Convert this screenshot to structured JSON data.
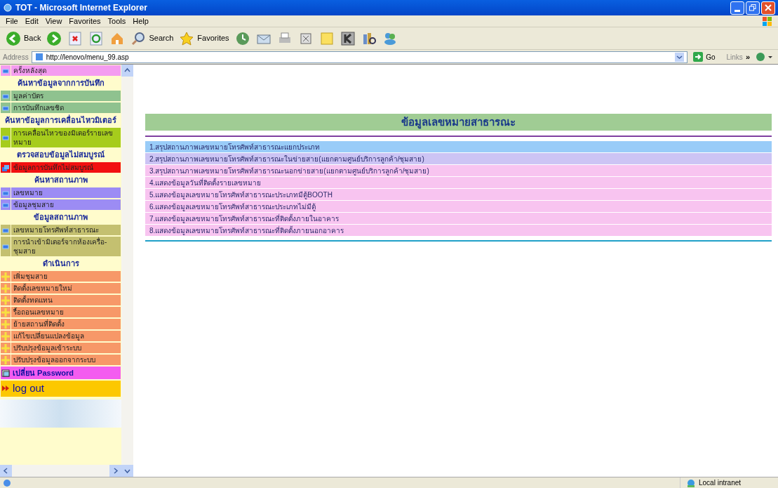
{
  "window": {
    "title": "TOT - Microsoft Internet Explorer"
  },
  "menu": [
    "File",
    "Edit",
    "View",
    "Favorites",
    "Tools",
    "Help"
  ],
  "toolbar": [
    {
      "kind": "back",
      "label": "Back"
    },
    {
      "kind": "forward"
    },
    {
      "kind": "stop"
    },
    {
      "kind": "refresh"
    },
    {
      "kind": "home"
    },
    {
      "kind": "search",
      "label": "Search"
    },
    {
      "kind": "favorites",
      "label": "Favorites"
    },
    {
      "kind": "history"
    },
    {
      "kind": "mail"
    },
    {
      "kind": "print"
    },
    {
      "kind": "edit"
    },
    {
      "kind": "note"
    },
    {
      "kind": "k"
    },
    {
      "kind": "research"
    },
    {
      "kind": "messenger"
    }
  ],
  "address": {
    "label": "Address",
    "value": "http://lenovo/menu_99.asp",
    "go": "Go",
    "links": "Links",
    "chevron": "»"
  },
  "sidebar": [
    {
      "kind": "bullet",
      "label": "ครั้งหลังสุด",
      "color": "#f49cf0"
    },
    {
      "kind": "header",
      "label": "ค้นหาข้อมูลจากการบันทึก"
    },
    {
      "kind": "bullet",
      "label": "มูลค่าบัตร",
      "color": "#8fc28f"
    },
    {
      "kind": "bullet",
      "label": "การบันทึกเลขชิด",
      "color": "#8fc28f"
    },
    {
      "kind": "header",
      "label": "ค้นหาข้อมูลการเคลื่อนไหวมิเตอร์"
    },
    {
      "kind": "bullet",
      "label": "การเคลื่อนไหวของมิเตอร์รายเลขหมาย",
      "color": "#a6cc1c"
    },
    {
      "kind": "header",
      "label": "ตรวจสอบข้อมูลไม่สมบูรณ์"
    },
    {
      "kind": "window",
      "label": "ข้อมูลการบันทึกไม่สมบูรณ์",
      "color": "#f21010"
    },
    {
      "kind": "header",
      "label": "ค้นหาสถานภาพ"
    },
    {
      "kind": "bullet",
      "label": "เลขหมาย",
      "color": "#9c8cf4"
    },
    {
      "kind": "bullet",
      "label": "ข้อมูลชุมสาย",
      "color": "#9c8cf4"
    },
    {
      "kind": "header",
      "label": "ข้อมูลสถานภาพ"
    },
    {
      "kind": "bullet",
      "label": "เลขหมายโทรศัพท์สาธารณะ",
      "color": "#c4c070"
    },
    {
      "kind": "bullet",
      "label": "การนำเข้ามิเตอร์จากห้องเครื่อ-ชุมสาย",
      "color": "#c4c070"
    },
    {
      "kind": "header",
      "label": "ดำเนินการ"
    },
    {
      "kind": "plus",
      "label": "เพิ่มชุมสาย",
      "color": "#f79868"
    },
    {
      "kind": "plus",
      "label": "ติดตั้งเลขหมายใหม่",
      "color": "#f79868"
    },
    {
      "kind": "plus",
      "label": "ติดตั้งทดแทน",
      "color": "#f79868"
    },
    {
      "kind": "plus",
      "label": "รื้อถอนเลขหมาย",
      "color": "#f79868"
    },
    {
      "kind": "plus",
      "label": "ย้ายสถานที่ติดตั้ง",
      "color": "#f79868"
    },
    {
      "kind": "plus",
      "label": "แก้ไขเปลี่ยนแปลงข้อมูล",
      "color": "#f79868"
    },
    {
      "kind": "plus",
      "label": "ปรับปรุงข้อมูลเข้าระบบ",
      "color": "#f79868"
    },
    {
      "kind": "plus",
      "label": "ปรับปรุงข้อมูลออกจากระบบ",
      "color": "#f79868"
    },
    {
      "kind": "password",
      "label": "เปลี่ยน Password",
      "color": "#f45cf0"
    },
    {
      "kind": "logout",
      "label": "log out",
      "color": "#fcc800"
    }
  ],
  "panel": {
    "title": "ข้อมูลเลขหมายสาธารณะ",
    "rows": [
      {
        "label": "1.สรุปสถานภาพเลขหมายโทรศัพท์สาธารณะแยกประเภท",
        "color": "#99ccf8"
      },
      {
        "label": "2.สรุปสถานภาพเลขหมายโทรศัพท์สาธารณะในข่ายสาย(แยกตามศูนย์บริการลูกค้า/ชุมสาย)",
        "color": "#ccc4f4"
      },
      {
        "label": "3.สรุปสถานภาพเลขหมายโทรศัพท์สาธารณะนอกข่ายสาย(แยกตามศูนย์บริการลูกค้า/ชุมสาย)",
        "color": "#f8c4f0"
      },
      {
        "label": "4.แสดงข้อมูลวันที่ติดตั้งรายเลขหมาย",
        "color": "#f8c4f0"
      },
      {
        "label": "5.แสดงข้อมูลเลขหมายโทรศัพท์สาธารณะประเภทมีตู้BOOTH",
        "color": "#f8c4f0"
      },
      {
        "label": "6.แสดงข้อมูลเลขหมายโทรศัพท์สาธารณะประเภทไม่มีตู้",
        "color": "#f8c4f0"
      },
      {
        "label": "7.แสดงข้อมูลเลขหมายโทรศัพท์สาธารณะที่ติดตั้งภายในอาคาร",
        "color": "#f8c4f0"
      },
      {
        "label": "8.แสดงข้อมูลเลขหมายโทรศัพท์สาธารณะที่ติดตั้งภายนอกอาคาร",
        "color": "#f8c4f0"
      }
    ]
  },
  "status_bar": {
    "zone": "Local intranet"
  }
}
